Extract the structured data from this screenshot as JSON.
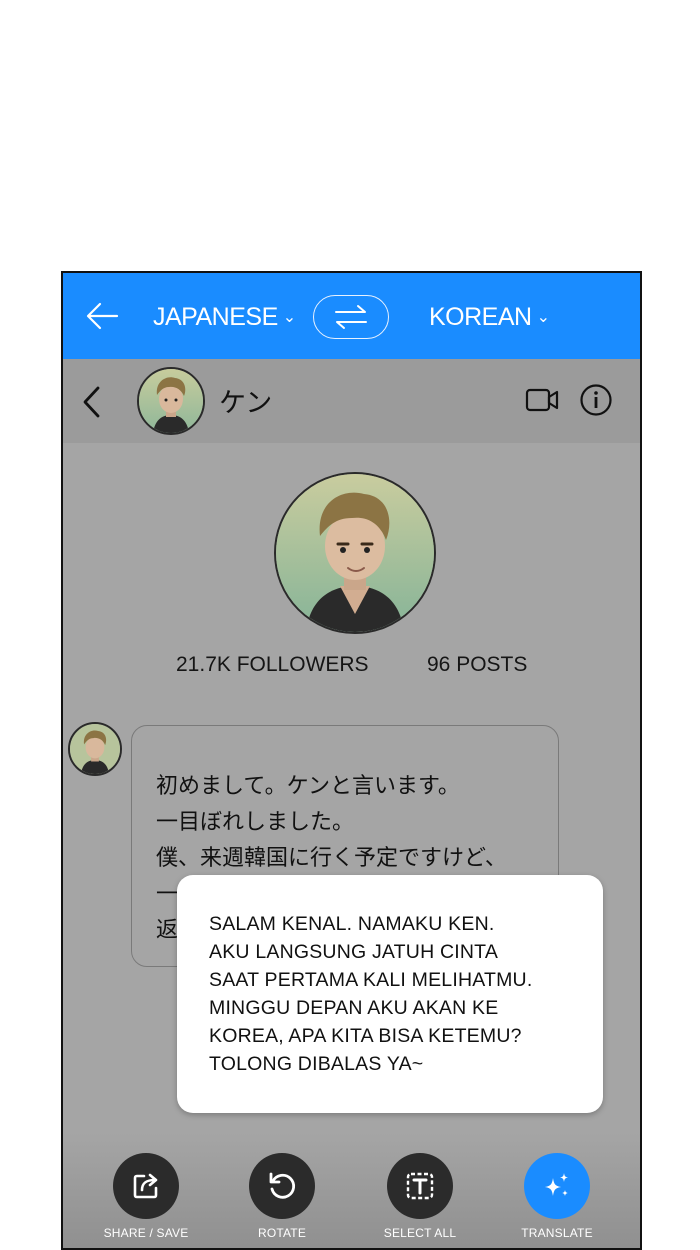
{
  "top_bar": {
    "source_language": "JAPANESE",
    "target_language": "KOREAN"
  },
  "chat_header": {
    "name": "ケン"
  },
  "profile": {
    "followers": "21.7K FOLLOWERS",
    "posts": "96 POSTS"
  },
  "message": {
    "lines": [
      "初めまして。ケンと言います。",
      "一目ぼれしました。",
      "僕、来週韓国に行く予定ですけど、",
      "一",
      "返"
    ]
  },
  "translation": {
    "lines": [
      "SALAM KENAL. NAMAKU KEN.",
      "AKU LANGSUNG JATUH CINTA",
      "SAAT PERTAMA KALI MELIHATMU.",
      "MINGGU DEPAN AKU AKAN KE",
      "KOREA, APA KITA BISA KETEMU?",
      "TOLONG DIBALAS YA~"
    ]
  },
  "toolbar": {
    "share_label": "SHARE / SAVE",
    "rotate_label": "ROTATE",
    "select_all_label": "SELECT ALL",
    "translate_label": "TRANSLATE"
  },
  "colors": {
    "accent": "#1a8cff",
    "dimmed_background": "#a5a5a5",
    "tool_button": "#2b2b2b"
  },
  "icons": [
    "back-arrow-icon",
    "swap-icon",
    "chevron-left-icon",
    "video-icon",
    "info-icon",
    "share-icon",
    "rotate-icon",
    "select-all-icon",
    "sparkle-icon"
  ]
}
